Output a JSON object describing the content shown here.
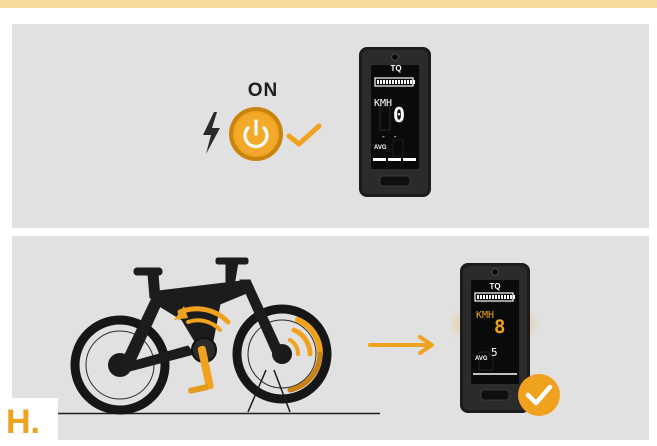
{
  "top_panel": {
    "state_label": "ON",
    "icons": [
      "lightning-icon",
      "power-button-icon",
      "check-icon"
    ],
    "display": {
      "logo": "TQ",
      "unit": "KMH",
      "speed": "0",
      "dash": "- -",
      "avg_label": "AVG"
    }
  },
  "bottom_panel": {
    "display": {
      "logo": "TQ",
      "unit": "KMH",
      "speed": "8",
      "secondary_value": "5",
      "avg_label": "AVG"
    },
    "icons": [
      "bicycle-illustration",
      "arrow-right-icon",
      "check-badge-icon"
    ]
  },
  "step_label": "H.",
  "colors": {
    "accent": "#f0a21f",
    "panel_bg": "#e1e1e1",
    "top_strip": "#f7d99b",
    "dark": "#1e1e1e"
  }
}
